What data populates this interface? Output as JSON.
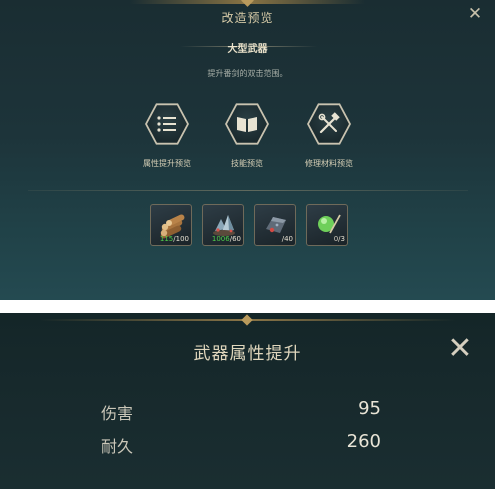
{
  "top_panel": {
    "title": "改造预览",
    "subtitle": "大型武器",
    "description": "提升番剑的双击范围。",
    "close_icon": "close-icon",
    "tools": [
      {
        "label": "属性提升预览",
        "icon": "list-icon"
      },
      {
        "label": "技能预览",
        "icon": "book-icon"
      },
      {
        "label": "修理材料预览",
        "icon": "wrench-hammer-icon"
      }
    ],
    "materials": [
      {
        "icon": "wood-logs-icon",
        "have": "115",
        "sep": "/",
        "need": "100",
        "have_color": "#4fcf4a"
      },
      {
        "icon": "crystal-ore-icon",
        "have": "1006",
        "sep": "/",
        "need": "60",
        "have_color": "#4fcf4a"
      },
      {
        "icon": "iron-ingot-icon",
        "have": "",
        "sep": "/",
        "need": "40",
        "have_color": "#d3cec1"
      },
      {
        "icon": "green-orb-icon",
        "have": "0",
        "sep": "/",
        "need": "3",
        "have_color": "#d3cec1"
      }
    ]
  },
  "bottom_panel": {
    "title": "武器属性提升",
    "close_icon": "close-icon",
    "stats": [
      {
        "name": "伤害",
        "value": "95"
      },
      {
        "name": "耐久",
        "value": "260"
      }
    ]
  },
  "colors": {
    "accent_gold": "#b99a5c",
    "have_enough": "#4fcf4a",
    "text_light": "#e8e4d6"
  }
}
